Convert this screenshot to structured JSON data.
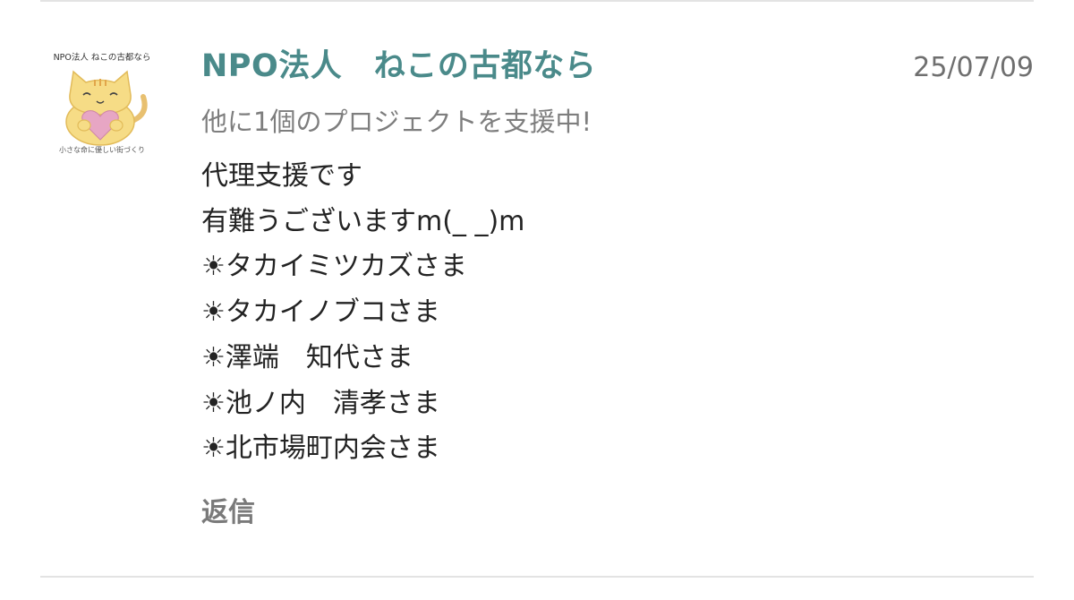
{
  "comment": {
    "author": "NPO法人　ねこの古都なら",
    "date": "25/07/09",
    "support_note": "他に1個のプロジェクトを支援中!",
    "message_lines": [
      "代理支援です",
      "有難うございますm(_ _)m",
      "☀タカイミツカズさま",
      "☀タカイノブコさま",
      "☀澤端　知代さま",
      "☀池ノ内　清孝さま",
      "☀北市場町内会さま"
    ],
    "reply_label": "返信",
    "avatar": {
      "icon": "cat-holding-heart-logo",
      "logo_top_text": "NPO法人 ねこの古都なら",
      "logo_bottom_text": "小さな命に優しい街づくり"
    }
  },
  "colors": {
    "author": "#4a8a8a",
    "date": "#6f6f6f",
    "support_note": "#7e7e7e",
    "message": "#232323",
    "reply": "#7a7a7a",
    "divider": "#e3e3e3"
  }
}
